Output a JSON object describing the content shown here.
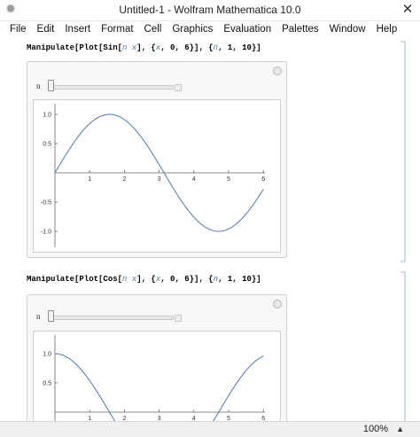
{
  "window": {
    "title": "Untitled-1 - Wolfram Mathematica 10.0",
    "close_glyph": "✕",
    "app_icon": "gear-icon"
  },
  "menu": [
    "File",
    "Edit",
    "Insert",
    "Format",
    "Cell",
    "Graphics",
    "Evaluation",
    "Palettes",
    "Window",
    "Help"
  ],
  "cells": [
    {
      "input_parts": [
        "Manipulate[Plot[Sin[",
        "n x",
        "], {",
        "x",
        ", 0, 6}], {",
        "n",
        ", 1, 10}]"
      ],
      "control": {
        "label": "n",
        "value": 1,
        "min": 1,
        "max": 10
      },
      "plot": {
        "function": "sin",
        "x_ticks": [
          "1",
          "2",
          "3",
          "4",
          "5",
          "6"
        ],
        "y_ticks": [
          "1.0",
          "0.5",
          "-0.5",
          "-1.0"
        ]
      }
    },
    {
      "input_parts": [
        "Manipulate[Plot[Cos[",
        "n x",
        "], {",
        "x",
        ", 0, 6}], {",
        "n",
        ", 1, 10}]"
      ],
      "control": {
        "label": "n",
        "value": 1,
        "min": 1,
        "max": 10
      },
      "plot": {
        "function": "cos",
        "x_ticks": [
          "1",
          "2",
          "3",
          "4",
          "5",
          "6"
        ],
        "y_ticks": [
          "1.0",
          "0.5"
        ]
      }
    }
  ],
  "status": {
    "zoom": "100%",
    "zoom_arrow": "▲"
  },
  "colors": {
    "curve": "#5e81b5",
    "bracket": "#9fb8d6",
    "var": "#4b7aa6"
  }
}
